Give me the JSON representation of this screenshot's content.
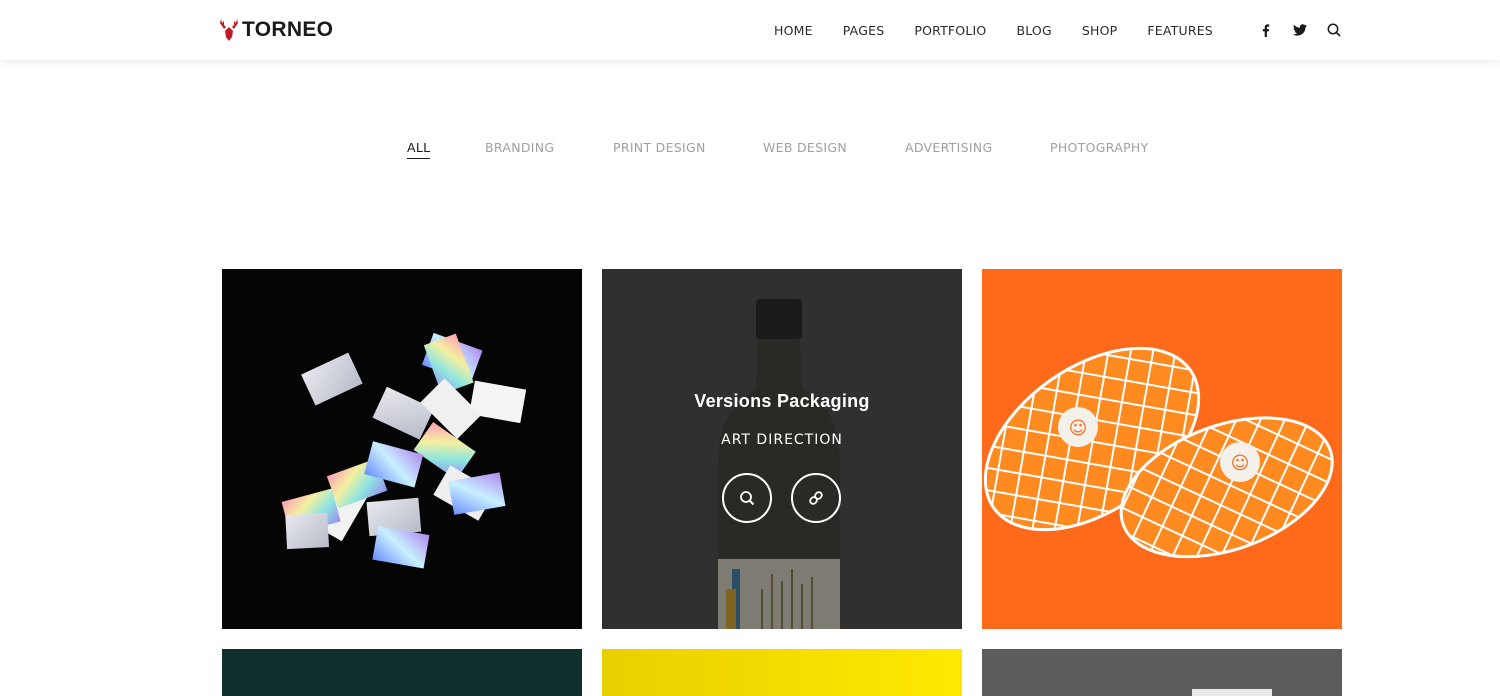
{
  "brand": {
    "name": "TORNEO",
    "accent": "#c0172b"
  },
  "nav": {
    "items": [
      {
        "label": "HOME"
      },
      {
        "label": "PAGES"
      },
      {
        "label": "PORTFOLIO"
      },
      {
        "label": "BLOG"
      },
      {
        "label": "SHOP"
      },
      {
        "label": "FEATURES"
      }
    ],
    "icons": [
      "facebook-icon",
      "twitter-icon",
      "search-icon"
    ]
  },
  "filters": {
    "active": "ALL",
    "items": [
      {
        "label": "ALL"
      },
      {
        "label": "BRANDING"
      },
      {
        "label": "PRINT DESIGN"
      },
      {
        "label": "WEB DESIGN"
      },
      {
        "label": "ADVERTISING"
      },
      {
        "label": "PHOTOGRAPHY"
      }
    ]
  },
  "portfolio": {
    "hovered": {
      "title": "Versions Packaging",
      "category": "ART DIRECTION",
      "actions": [
        "zoom-icon",
        "link-icon"
      ]
    },
    "tile_colors": [
      "#050505",
      "#3a3a3a",
      "#ff6a1a",
      "#0f2e2c",
      "#ffe800",
      "#5a5a5a"
    ]
  }
}
